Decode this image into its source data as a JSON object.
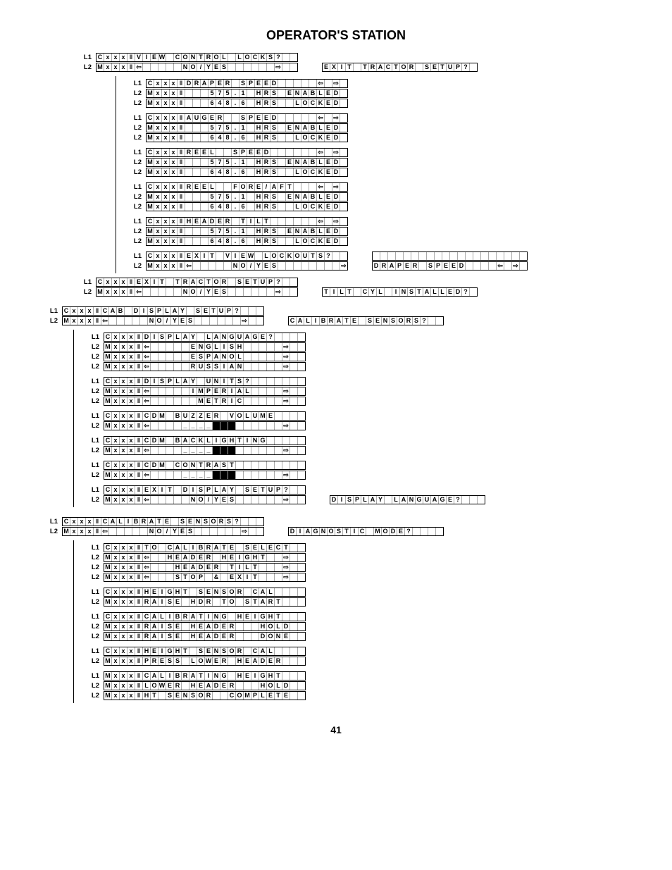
{
  "title": "OPERATOR'S STATION",
  "page_number": "41",
  "arrows": {
    "left": "⇦",
    "right": "⇨",
    "pair_l": "⇦",
    "pair_r": "⇨"
  },
  "labels": {
    "L1": "L1",
    "L2": "L2"
  },
  "strings": {
    "cxxx": "Cxxx",
    "mxxx": "Mxxx",
    "view_control_locks": "VIEW CONTROL LOCKS?",
    "no_yes": "NO/YES",
    "exit_tractor_setup": "EXIT TRACTOR SETUP?",
    "draper_speed": "DRAPER SPEED",
    "auger_speed": "AUGER  SPEED",
    "reel_speed": "REEL  SPEED",
    "reel_foreaft": "REEL  FORE/AFT",
    "header_tilt": "HEADER TILT",
    "val_575_1": "575.1",
    "val_648_6": "648.6",
    "hrs": "HRS",
    "enabled": "ENABLED",
    "locked": "LOCKED",
    "exit_view_lockouts": "EXIT VIEW LOCKOUTS?",
    "draper_speed_side": "DRAPER SPEED",
    "exit_tractor_setup2": "EXIT TRACTOR SETUP?",
    "tilt_cyl_installed": "TILT CYL INSTALLED?",
    "cab_display_setup": "CAB DISPLAY SETUP?",
    "calibrate_sensors": "CALIBRATE SENSORS?",
    "display_language": "DISPLAY LANGUAGE?",
    "english": "ENGLISH",
    "espanol": "ESPANOL",
    "russian": "RUSSIAN",
    "display_units": "DISPLAY UNITS?",
    "imperial": "IMPERIAL",
    "metric": "METRIC",
    "cdm_buzzer_volume": "CDM BUZZER VOLUME",
    "cdm_backlighting": "CDM BACKLIGHTING",
    "cdm_contrast": "CDM CONTRAST",
    "exit_display_setup": "EXIT DISPLAY SETUP?",
    "display_language_side": "DISPLAY LANGUAGE?",
    "calibrate_sensors_hdr": "CALIBRATE SENSORS?",
    "diagnostic_mode": "DIAGNOSTIC MODE?",
    "to_calibrate_select": "TO CALIBRATE SELECT",
    "header_height": "HEADER HEIGHT",
    "header_tilt2": "HEADER TILT",
    "stop_and_exit": "STOP & EXIT",
    "height_sensor_cal": "HEIGHT SENSOR CAL",
    "raise_hdr_to_start": "RAISE HDR TO START",
    "calibrating_height": "CALIBRATING HEIGHT",
    "raise_header": "RAISE HEADER",
    "hold": "HOLD",
    "done": "DONE",
    "press_lower_header": "PRESS LOWER HEADER",
    "lower_header": "LOWER HEADER",
    "ht_sensor": "HT SENSOR",
    "complete": "COMPLETE"
  }
}
